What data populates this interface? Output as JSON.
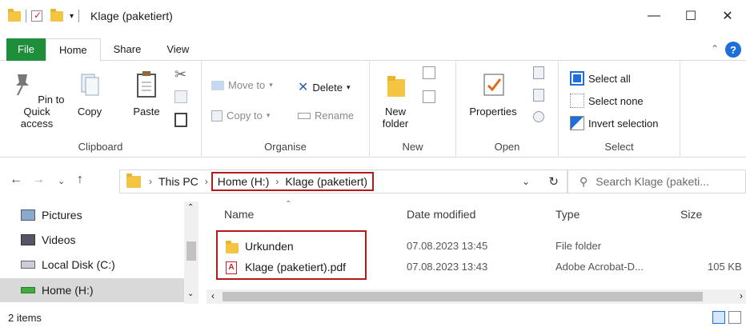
{
  "window": {
    "title": "Klage (paketiert)",
    "minimize": "—",
    "maximize": "☐",
    "close": "✕"
  },
  "ribbon_tabs": [
    "File",
    "Home",
    "Share",
    "View"
  ],
  "clipboard": {
    "pin": "Pin to Quick access",
    "copy": "Copy",
    "paste": "Paste",
    "label": "Clipboard"
  },
  "organise": {
    "move_to": "Move to",
    "copy_to": "Copy to",
    "delete": "Delete",
    "rename": "Rename",
    "label": "Organise"
  },
  "new": {
    "new_folder": "New folder",
    "label": "New"
  },
  "open": {
    "properties": "Properties",
    "label": "Open"
  },
  "select": {
    "select_all": "Select all",
    "select_none": "Select none",
    "invert": "Invert selection",
    "label": "Select"
  },
  "address": {
    "crumbs": [
      "This PC",
      "Home (H:)",
      "Klage (paketiert)"
    ],
    "search_placeholder": "Search Klage (paketi..."
  },
  "nav_pane": [
    {
      "label": "Pictures",
      "icon": "pictures-icon"
    },
    {
      "label": "Videos",
      "icon": "videos-icon"
    },
    {
      "label": "Local Disk (C:)",
      "icon": "drive-icon"
    },
    {
      "label": "Home (H:)",
      "icon": "network-drive-icon",
      "selected": true
    }
  ],
  "columns": {
    "name": "Name",
    "date": "Date modified",
    "type": "Type",
    "size": "Size"
  },
  "files": [
    {
      "name": "Urkunden",
      "date": "07.08.2023 13:45",
      "type": "File folder",
      "size": "",
      "icon": "folder-icon"
    },
    {
      "name": "Klage (paketiert).pdf",
      "date": "07.08.2023 13:43",
      "type": "Adobe Acrobat-D...",
      "size": "105 KB",
      "icon": "pdf-icon"
    }
  ],
  "status": {
    "items": "2 items"
  },
  "colors": {
    "file_tab": "#1f8e3a",
    "highlight": "#b31b1b",
    "folder": "#f4c542",
    "accent": "#1e6fd9"
  }
}
